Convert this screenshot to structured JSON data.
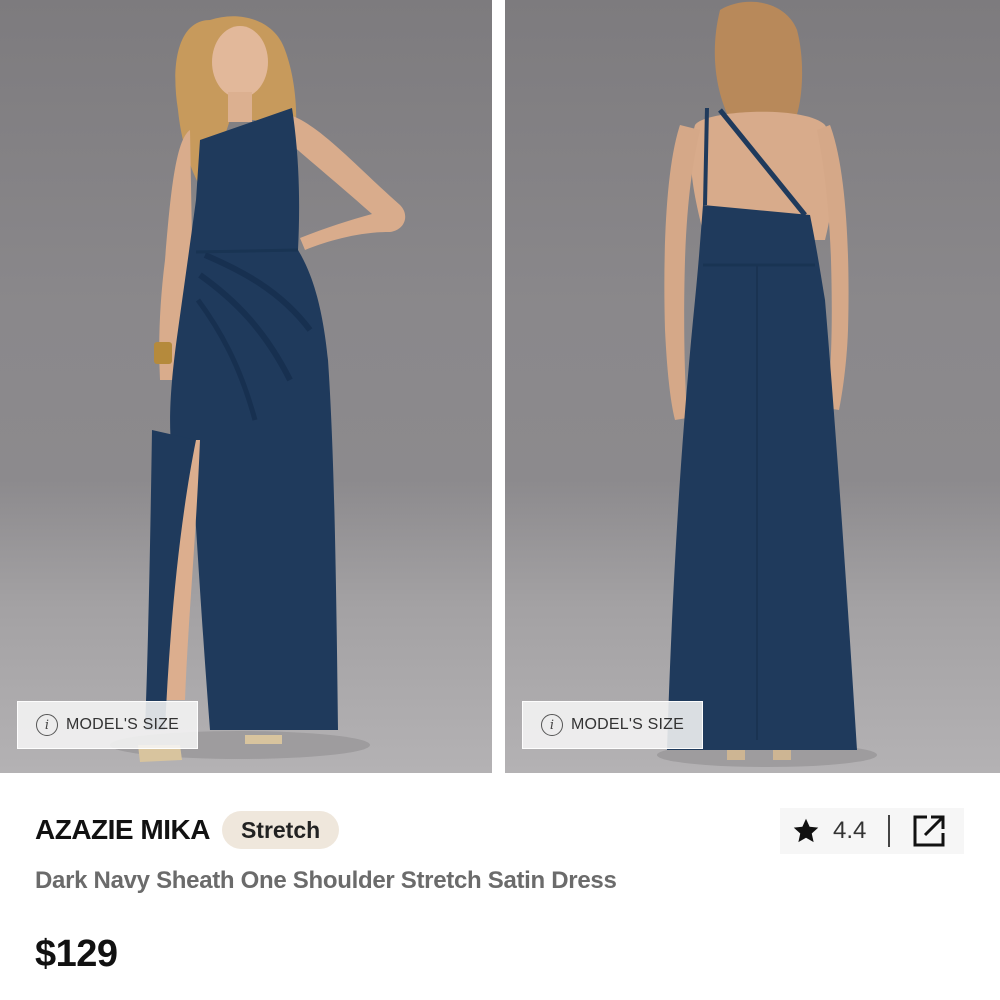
{
  "gallery": {
    "model_size_label": "MODEL'S SIZE",
    "info_icon_glyph": "i"
  },
  "product": {
    "brand": "AZAZIE MIKA",
    "badge": "Stretch",
    "name": "Dark Navy Sheath One Shoulder Stretch Satin Dress",
    "price": "$129",
    "rating": "4.4"
  },
  "icons": {
    "star": "star-icon",
    "share": "share-icon",
    "info": "info-icon"
  },
  "colors": {
    "dress": "#1f3a5c",
    "badge_bg": "#efe7dc",
    "backdrop": "#8a888b"
  }
}
